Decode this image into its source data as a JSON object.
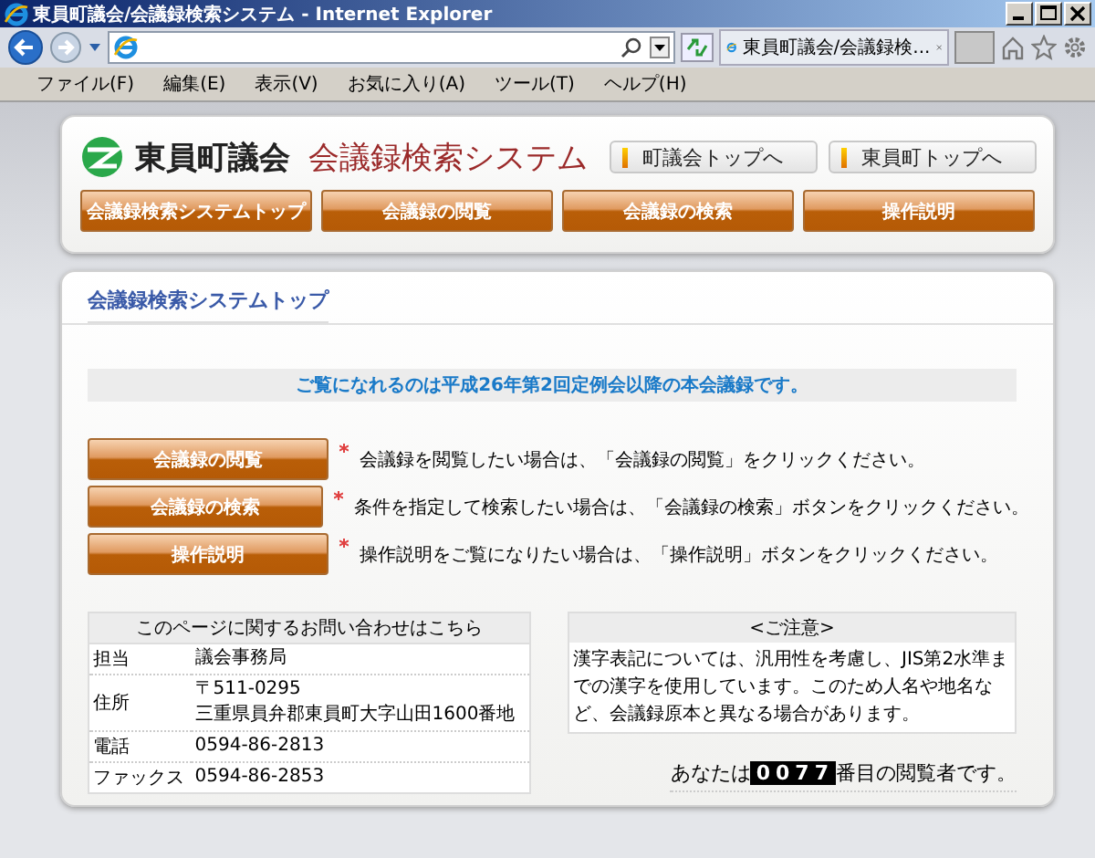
{
  "window": {
    "title": "東員町議会/会議録検索システム - Internet Explorer"
  },
  "browser": {
    "tab_title": "東員町議会/会議録検...",
    "menu": [
      "ファイル(F)",
      "編集(E)",
      "表示(V)",
      "お気に入り(A)",
      "ツール(T)",
      "ヘルプ(H)"
    ]
  },
  "site": {
    "logo_text": "東員町議会",
    "system_title": "会議録検索システム",
    "links": [
      "町議会トップへ",
      "東員町トップへ"
    ],
    "nav": [
      "会議録検索システムトップ",
      "会議録の閲覧",
      "会議録の検索",
      "操作説明"
    ]
  },
  "page": {
    "heading": "会議録検索システムトップ",
    "notice": "ご覧になれるのは平成26年第2回定例会以降の本会議録です。",
    "actions": [
      {
        "button": "会議録の閲覧",
        "description": "会議録を閲覧したい場合は、「会議録の閲覧」をクリックください。"
      },
      {
        "button": "会議録の検索",
        "description": "条件を指定して検索したい場合は、「会議録の検索」ボタンをクリックください。"
      },
      {
        "button": "操作説明",
        "description": "操作説明をご覧になりたい場合は、「操作説明」ボタンをクリックください。"
      }
    ],
    "contact": {
      "title": "このページに関するお問い合わせはこちら",
      "rows": [
        {
          "label": "担当",
          "values": [
            "議会事務局"
          ]
        },
        {
          "label": "住所",
          "values": [
            "〒511-0295",
            "三重県員弁郡東員町大字山田1600番地"
          ]
        },
        {
          "label": "電話",
          "values": [
            "0594-86-2813"
          ]
        },
        {
          "label": "ファックス",
          "values": [
            "0594-86-2853"
          ]
        }
      ]
    },
    "caution": {
      "title": "<ご注意>",
      "text": "漢字表記については、汎用性を考慮し、JIS第2水準までの漢字を使用しています。このため人名や地名など、会議録原本と異なる場合があります。"
    },
    "counter": {
      "prefix": "あなたは",
      "count": "0077",
      "suffix": "番目の閲覧者です。"
    }
  }
}
